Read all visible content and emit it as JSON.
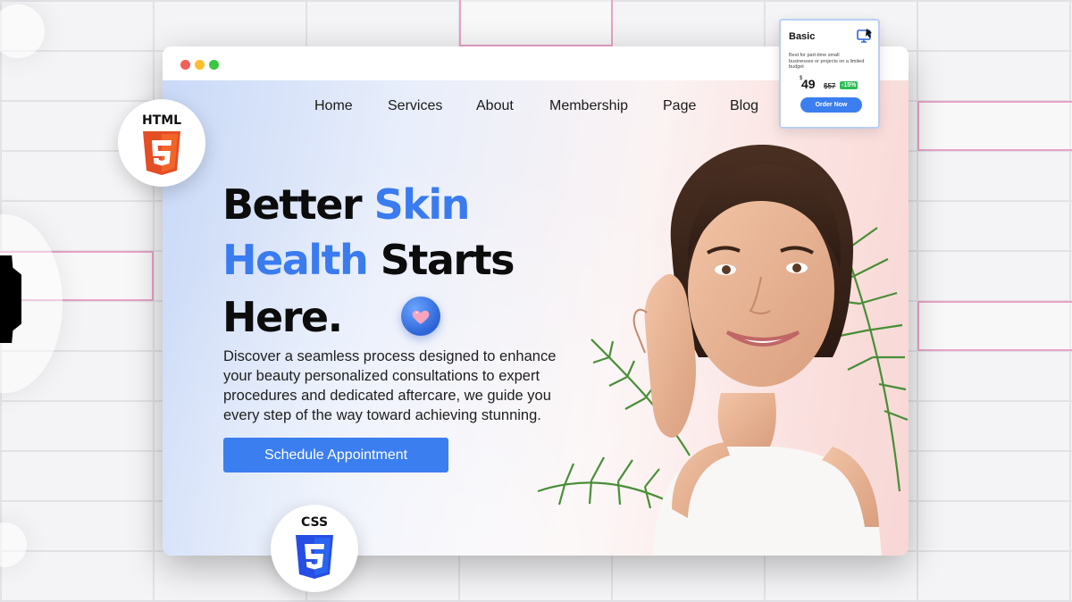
{
  "nav": {
    "items": [
      "Home",
      "Services",
      "About",
      "Membership",
      "Page",
      "Blog"
    ]
  },
  "hero": {
    "line1_black": "Better",
    "line1_blue": "Skin",
    "line2_blue": "Health",
    "line2_black": "Starts",
    "line3": "Here.",
    "paragraph": "Discover a seamless process designed to enhance your beauty personalized consultations to expert procedures and dedicated aftercare, we guide you every step of the way toward achieving stunning.",
    "cta_label": "Schedule Appointment"
  },
  "badges": {
    "html": "HTML",
    "css": "CSS"
  },
  "pricing_card": {
    "title": "Basic",
    "description": "Best for part-time small businesses or projects on a limited budget",
    "currency": "$",
    "price": "49",
    "old_price": "$57",
    "discount": "-15%",
    "button_label": "Order Now"
  },
  "colors": {
    "accent_blue": "#3b7ef0",
    "html5_orange": "#e44d26",
    "css3_blue": "#264de4",
    "discount_green": "#2bbd52",
    "grid_pink": "#e7a3c6"
  },
  "icons": [
    "html5-shield-icon",
    "css3-shield-icon",
    "heart-icon",
    "order-icon"
  ]
}
